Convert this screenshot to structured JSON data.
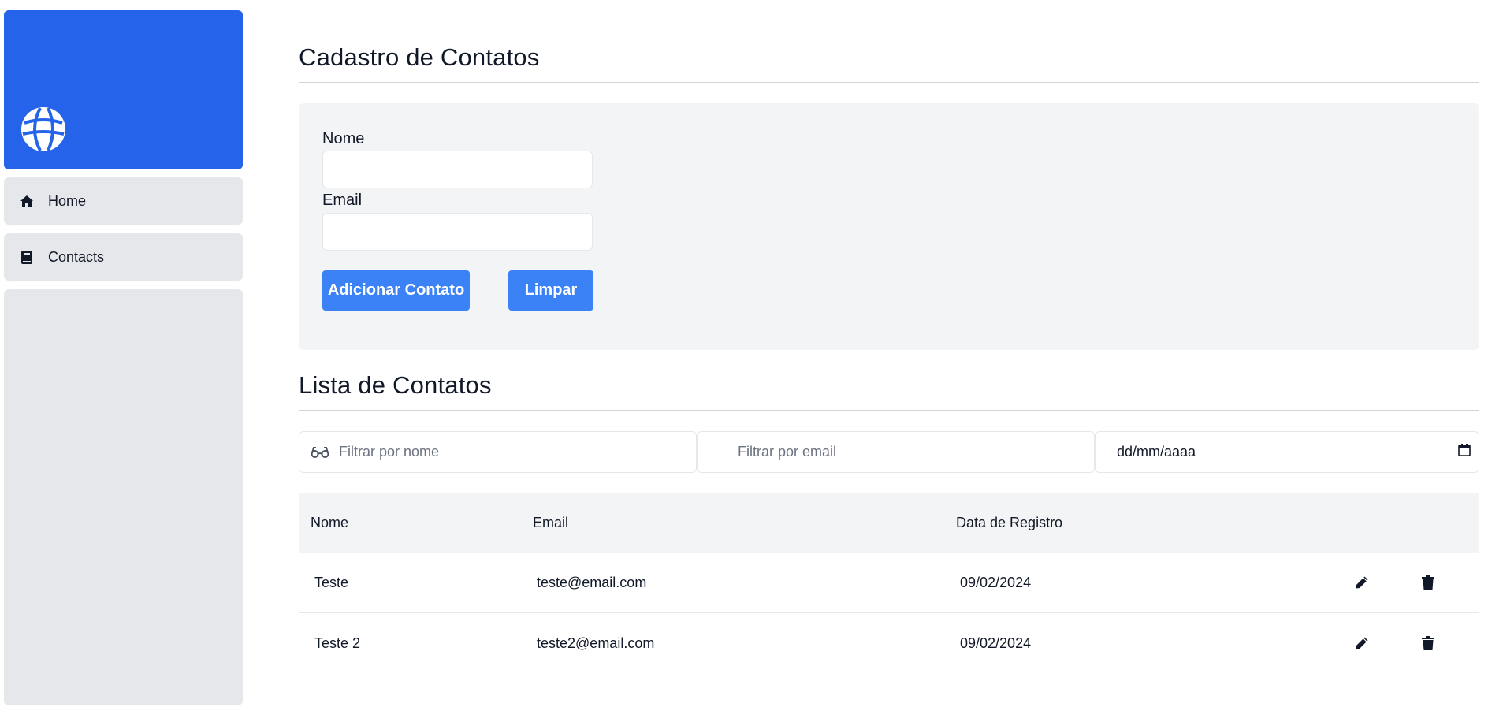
{
  "sidebar": {
    "items": [
      {
        "label": "Home",
        "icon": "home-icon"
      },
      {
        "label": "Contacts",
        "icon": "address-book-icon"
      }
    ],
    "brand_icon": "globe-icon"
  },
  "form": {
    "title": "Cadastro de Contatos",
    "name_label": "Nome",
    "email_label": "Email",
    "name_value": "",
    "email_value": "",
    "add_button": "Adicionar Contato",
    "clear_button": "Limpar"
  },
  "list": {
    "title": "Lista de Contatos",
    "filters": {
      "name_placeholder": "Filtrar por nome",
      "email_placeholder": "Filtrar por email",
      "date_placeholder": "dd/mm/aaaa"
    },
    "columns": [
      "Nome",
      "Email",
      "Data de Registro"
    ],
    "rows": [
      {
        "nome": "Teste",
        "email": "teste@email.com",
        "data": "09/02/2024"
      },
      {
        "nome": "Teste 2",
        "email": "teste2@email.com",
        "data": "09/02/2024"
      }
    ]
  },
  "colors": {
    "brand": "#2563eb",
    "button": "#3b82f6",
    "panel": "#f3f4f6",
    "sidebar_item": "#e5e7eb"
  }
}
